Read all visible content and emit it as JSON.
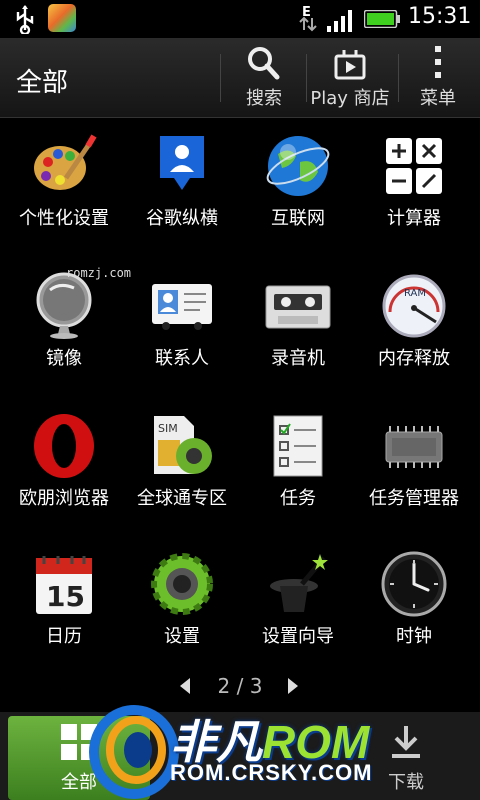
{
  "status_bar": {
    "time": "15:31",
    "network_type": "E"
  },
  "action_bar": {
    "title": "全部",
    "search_label": "搜索",
    "store_label": "Play 商店",
    "menu_label": "菜单"
  },
  "apps": [
    {
      "label": "个性化设置",
      "icon": "palette-icon"
    },
    {
      "label": "谷歌纵横",
      "icon": "latitude-icon"
    },
    {
      "label": "互联网",
      "icon": "globe-icon"
    },
    {
      "label": "计算器",
      "icon": "calculator-icon"
    },
    {
      "label": "镜像",
      "icon": "mirror-icon"
    },
    {
      "label": "联系人",
      "icon": "contacts-icon"
    },
    {
      "label": "录音机",
      "icon": "cassette-icon"
    },
    {
      "label": "内存释放",
      "icon": "ram-gauge-icon"
    },
    {
      "label": "欧朋浏览器",
      "icon": "opera-icon"
    },
    {
      "label": "全球通专区",
      "icon": "sim-gear-icon"
    },
    {
      "label": "任务",
      "icon": "tasks-icon"
    },
    {
      "label": "任务管理器",
      "icon": "chip-icon"
    },
    {
      "label": "日历",
      "icon": "calendar-icon"
    },
    {
      "label": "设置",
      "icon": "settings-gear-icon"
    },
    {
      "label": "设置向导",
      "icon": "magic-hat-icon"
    },
    {
      "label": "时钟",
      "icon": "clock-icon"
    }
  ],
  "calendar_day": "15",
  "ram_text": "RAM",
  "sim_text": "SIM",
  "watermark_small": "romzj.com",
  "pager": {
    "text": "2 / 3"
  },
  "tabs": [
    {
      "label": "全部",
      "active": true
    },
    {
      "label": "下载",
      "active": false
    }
  ],
  "watermark_logo": {
    "brand": "非凡",
    "rom": "ROM",
    "url": "ROM.CRSKY.COM"
  },
  "colors": {
    "accent_green": "#6db33f",
    "background": "#000000",
    "watermark_blue": "#0b3c8c"
  }
}
